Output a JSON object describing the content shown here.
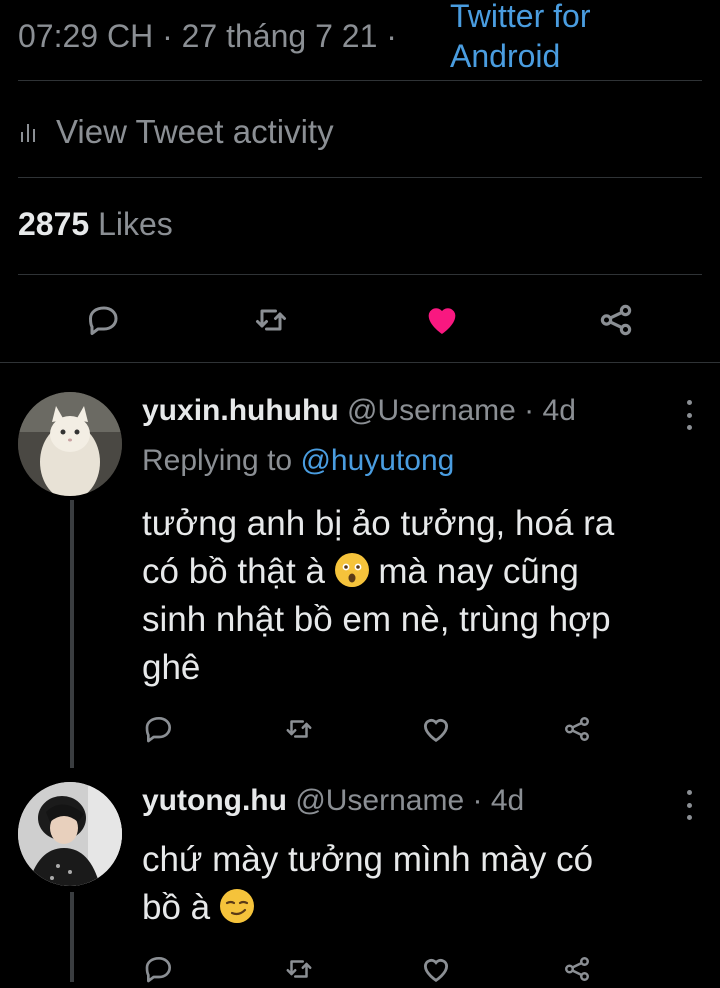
{
  "tweet_meta": {
    "time": "07:29 CH · 27 tháng 7 21 ·",
    "source_line1": "Twitter for",
    "source_line2": "Android"
  },
  "activity": {
    "label": "View Tweet activity",
    "icon": "bar-chart-icon"
  },
  "likes": {
    "count": "2875",
    "label": "Likes"
  },
  "actions": [
    "reply-icon",
    "retweet-icon",
    "like-icon-filled",
    "share-icon"
  ],
  "colors": {
    "background": "#000000",
    "link": "#4a9de0",
    "like": "#f91880",
    "muted": "#8b8f94"
  },
  "replies": [
    {
      "display_name": "yuxin.huhuhu",
      "handle": "@Username",
      "sep": "·",
      "age": "4d",
      "replying_label": "Replying to",
      "replying_to": "@huyutong",
      "text_l1": "tưởng anh bị ảo tưởng, hoá ra",
      "text_l2_a": "có bồ thật à",
      "text_l2_b": "mà nay cũng",
      "text_l3": "sinh nhật bồ em nè, trùng hợp",
      "text_l4": "ghê",
      "emoji": "astonished-face"
    },
    {
      "display_name": "yutong.hu",
      "handle": "@Username",
      "sep": "·",
      "age": "4d",
      "text_l1": "chứ mày tưởng mình mày có",
      "text_l2": "bồ à",
      "emoji": "smirking-face"
    }
  ]
}
